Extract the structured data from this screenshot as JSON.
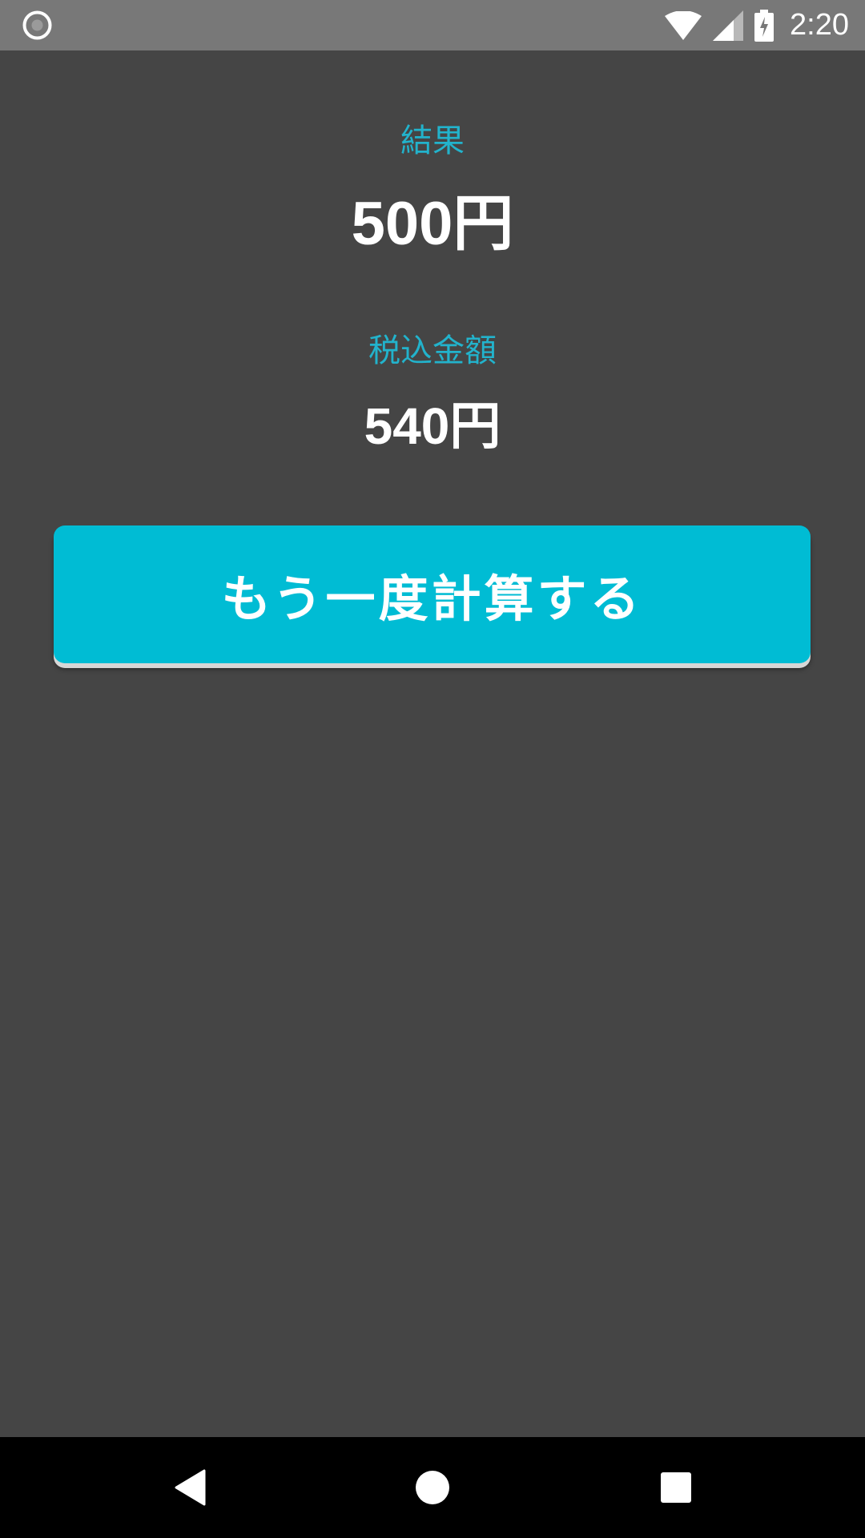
{
  "status_bar": {
    "time": "2:20",
    "icons": [
      "record-icon",
      "wifi-icon",
      "signal-icon",
      "battery-charging-icon"
    ]
  },
  "result": {
    "label": "結果",
    "value": "500円"
  },
  "tax_included": {
    "label": "税込金額",
    "value": "540円"
  },
  "recalculate_button": {
    "label": "もう一度計算する"
  },
  "navigation": {
    "icons": [
      "back-icon",
      "home-icon",
      "recents-icon"
    ]
  },
  "colors": {
    "background": "#454545",
    "accent": "#00bcd4",
    "label_text": "#22b3cc",
    "status_bar": "#787878",
    "nav_bar": "#000000"
  }
}
